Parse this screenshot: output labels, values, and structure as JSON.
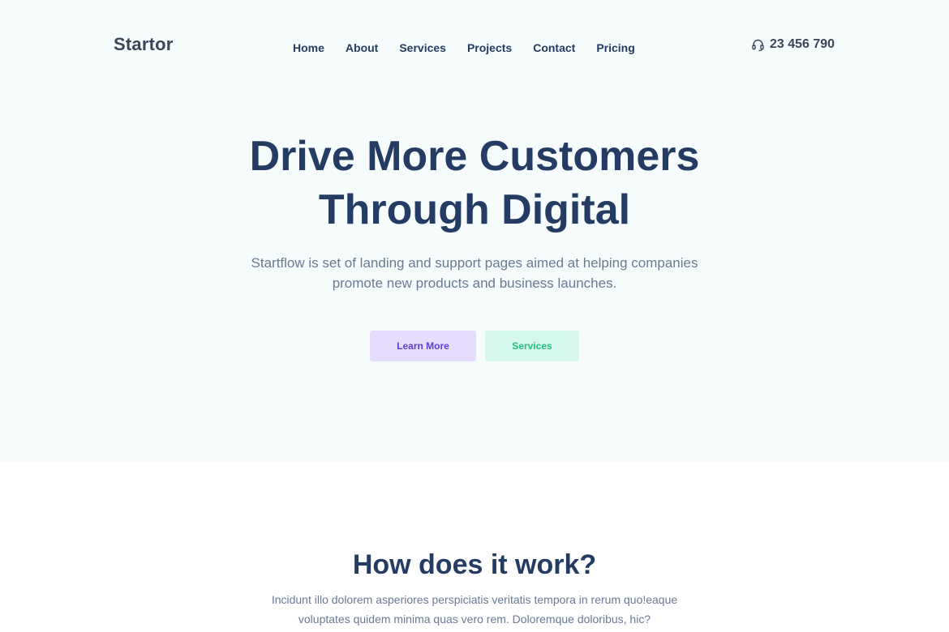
{
  "header": {
    "logo": "Startor",
    "nav": [
      "Home",
      "About",
      "Services",
      "Projects",
      "Contact",
      "Pricing"
    ],
    "phone_icon": "headset-icon",
    "phone": "23 456 790"
  },
  "hero": {
    "title_lines": [
      "Drive More Customers",
      "Through Digital"
    ],
    "subtitle_lines": [
      "Startflow is set of landing and support pages aimed at helping companies",
      "promote new products and business launches."
    ],
    "buttons": {
      "learn_more": "Learn More",
      "services": "Services"
    }
  },
  "how": {
    "title": "How does it work?",
    "subtitle_lines": [
      "Incidunt illo dolorem asperiores perspiciatis veritatis tempora in rerum quo!eaque",
      "voluptates quidem minima quas vero rem. Doloremque doloribus, hic?"
    ]
  },
  "colors": {
    "hero_bg": "#f6fcfc",
    "heading": "#243b63",
    "learn_more_bg": "#e6dcfb",
    "learn_more_text": "#5b3fd8",
    "services_bg": "#d6f7ee",
    "services_text": "#24c07f"
  }
}
